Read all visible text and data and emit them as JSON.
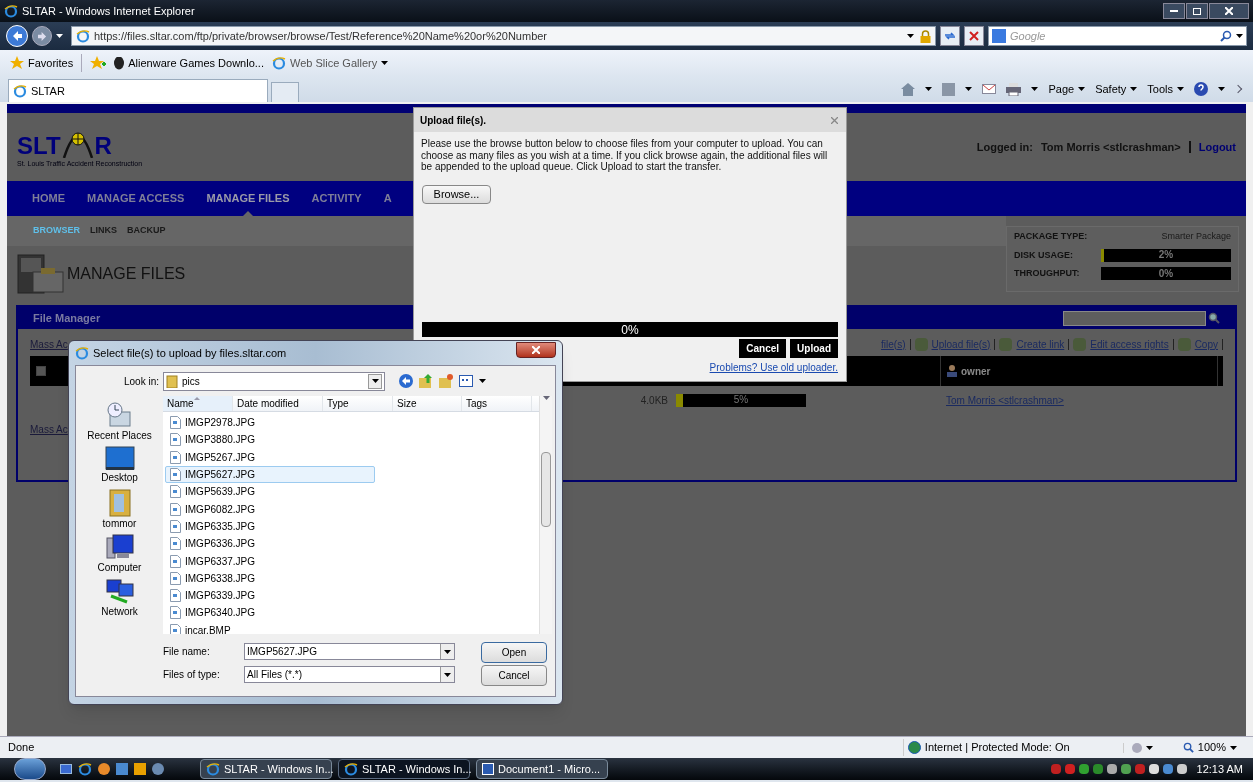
{
  "browser": {
    "title": "SLTAR - Windows Internet Explorer",
    "url": "https://files.sltar.com/ftp/private/browser/browse/Test/Reference%20Name%20or%20Number",
    "search_placeholder": "Google"
  },
  "favorites_bar": {
    "favorites": "Favorites",
    "links": [
      "Alienware Games Downlo...",
      "Web Slice Gallery"
    ]
  },
  "tabs": [
    {
      "label": "SLTAR",
      "selected": true
    }
  ],
  "command_bar": [
    "Page",
    "Safety",
    "Tools"
  ],
  "site": {
    "logo_left": "SLT",
    "logo_right": "R",
    "logo_caption": "St. Louis Traffic Accident Reconstruction",
    "login_label": "Logged in:",
    "login_user": "Tom Morris <stlcrashman>",
    "logout": "Logout"
  },
  "nav": [
    {
      "label": "HOME",
      "selected": false
    },
    {
      "label": "MANAGE ACCESS",
      "selected": false
    },
    {
      "label": "MANAGE FILES",
      "selected": true
    },
    {
      "label": "ACTIVITY",
      "selected": false
    },
    {
      "label": "A",
      "selected": false
    }
  ],
  "subnav": [
    {
      "label": "BROWSER",
      "selected": true
    },
    {
      "label": "LINKS",
      "selected": false
    },
    {
      "label": "BACKUP",
      "selected": false
    }
  ],
  "page_title": "MANAGE FILES",
  "package": {
    "type_label": "PACKAGE TYPE:",
    "type_value": "Smarter Package",
    "meters": [
      {
        "label": "DISK USAGE:",
        "level": 0.02,
        "reading": "2%"
      },
      {
        "label": "THROUGHPUT:",
        "level": 0,
        "reading": "0%"
      }
    ]
  },
  "file_manager": {
    "title": "File Manager",
    "mass_action_top": "Mass Ac",
    "actions": [
      "file(s)",
      "Upload file(s)",
      "Create link",
      "Edit access rights",
      "Copy"
    ],
    "header_checkbox": {
      "checked": false
    },
    "owner_column": "owner",
    "rows": [
      {
        "size": "4.0KB",
        "level": 0.05,
        "reading": "5%",
        "owner": "Tom Morris <stlcrashman>"
      }
    ],
    "mass_action_bottom": "Mass Ac"
  },
  "upload_dialog": {
    "title": "Upload file(s).",
    "text": "Please use the browse button below to choose files from your computer to upload. You can choose as many files as you wish at a time. If you click browse again, the additional files will be appended to the upload queue. Click Upload to start the transfer.",
    "browse": "Browse...",
    "progress": {
      "level": 0,
      "reading": "0%"
    },
    "buttons": [
      "Cancel",
      "Upload"
    ],
    "link": "Problems? Use old uploader."
  },
  "file_dialog": {
    "title": "Select file(s) to upload by files.sltar.com",
    "look_in_label": "Look in:",
    "folder": "pics",
    "places": [
      {
        "label": "Recent Places",
        "kind": "recent"
      },
      {
        "label": "Desktop",
        "kind": "desktop"
      },
      {
        "label": "tommor",
        "kind": "user"
      },
      {
        "label": "Computer",
        "kind": "computer"
      },
      {
        "label": "Network",
        "kind": "network"
      }
    ],
    "columns": [
      "Name",
      "Date modified",
      "Type",
      "Size",
      "Tags"
    ],
    "files": [
      {
        "name": "IMGP2978.JPG",
        "selected": false
      },
      {
        "name": "IMGP3880.JPG",
        "selected": false
      },
      {
        "name": "IMGP5267.JPG",
        "selected": false
      },
      {
        "name": "IMGP5627.JPG",
        "selected": true
      },
      {
        "name": "IMGP5639.JPG",
        "selected": false
      },
      {
        "name": "IMGP6082.JPG",
        "selected": false
      },
      {
        "name": "IMGP6335.JPG",
        "selected": false
      },
      {
        "name": "IMGP6336.JPG",
        "selected": false
      },
      {
        "name": "IMGP6337.JPG",
        "selected": false
      },
      {
        "name": "IMGP6338.JPG",
        "selected": false
      },
      {
        "name": "IMGP6339.JPG",
        "selected": false
      },
      {
        "name": "IMGP6340.JPG",
        "selected": false
      },
      {
        "name": "incar.BMP",
        "selected": false
      }
    ],
    "file_name_label": "File name:",
    "file_name": "IMGP5627.JPG",
    "type_label": "Files of type:",
    "file_type": "All Files (*.*)",
    "buttons": [
      "Open",
      "Cancel"
    ]
  },
  "status_bar": {
    "text": "Done",
    "zone": "Internet | Protected Mode: On",
    "zoom": "100%"
  },
  "taskbar": {
    "tasks": [
      {
        "label": "SLTAR - Windows In...",
        "selected": false
      },
      {
        "label": "SLTAR - Windows In...",
        "selected": true
      },
      {
        "label": "Document1 - Micro...",
        "selected": false
      }
    ],
    "clock": "12:13 AM"
  }
}
